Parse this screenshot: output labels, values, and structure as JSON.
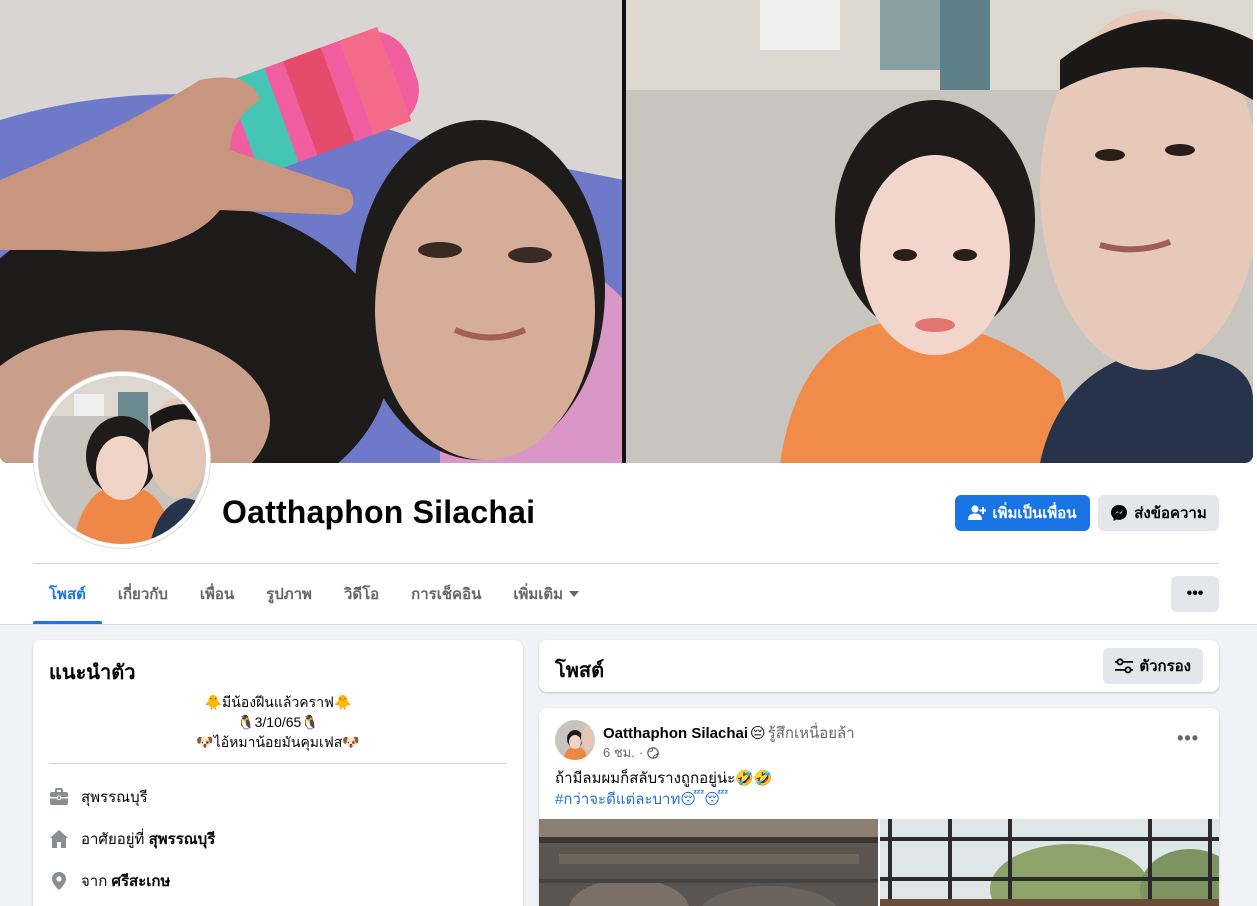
{
  "profile": {
    "name": "Oatthaphon Silachai"
  },
  "actions": {
    "add_friend": "เพิ่มเป็นเพื่อน",
    "message": "ส่งข้อความ"
  },
  "tabs": [
    {
      "label": "โพสต์"
    },
    {
      "label": "เกี่ยวกับ"
    },
    {
      "label": "เพื่อน"
    },
    {
      "label": "รูปภาพ"
    },
    {
      "label": "วิดีโอ"
    },
    {
      "label": "การเช็คอิน"
    },
    {
      "label": "เพิ่มเติม"
    }
  ],
  "more_menu_label": "•••",
  "intro": {
    "title": "แนะนำตัว",
    "bio": [
      "🐥มีน้องฝีนแล้วคราฟ🐥",
      "🐧3/10/65🐧",
      "🐶ไอ้หมาน้อยมันคุมเฟส🐶"
    ],
    "work": "สุพรรณบุรี",
    "lives_prefix": "อาศัยอยู่ที่",
    "lives_place": "สุพรรณบุรี",
    "from_prefix": "จาก",
    "from_place": "ศรีสะเกษ"
  },
  "posts_section": {
    "title": "โพสต์",
    "filter_label": "ตัวกรอง"
  },
  "post": {
    "author": "Oatthaphon Silachai",
    "feeling_emoji": "😔",
    "feeling": "รู้สึกเหนื่อยล้า",
    "time": "6 ชม.",
    "separator": "·",
    "menu": "•••",
    "text_line": "ถ้ามีลมผมก็สลับรางถูกอยู่น่ะ🤣🤣",
    "hashtag": "#กว่าจะดีแต่ละบาท😴😴"
  },
  "colors": {
    "primary": "#1b74e4",
    "secondary_bg": "#e4e6eb",
    "page_bg": "#f0f2f5",
    "muted_text": "#65676b"
  }
}
